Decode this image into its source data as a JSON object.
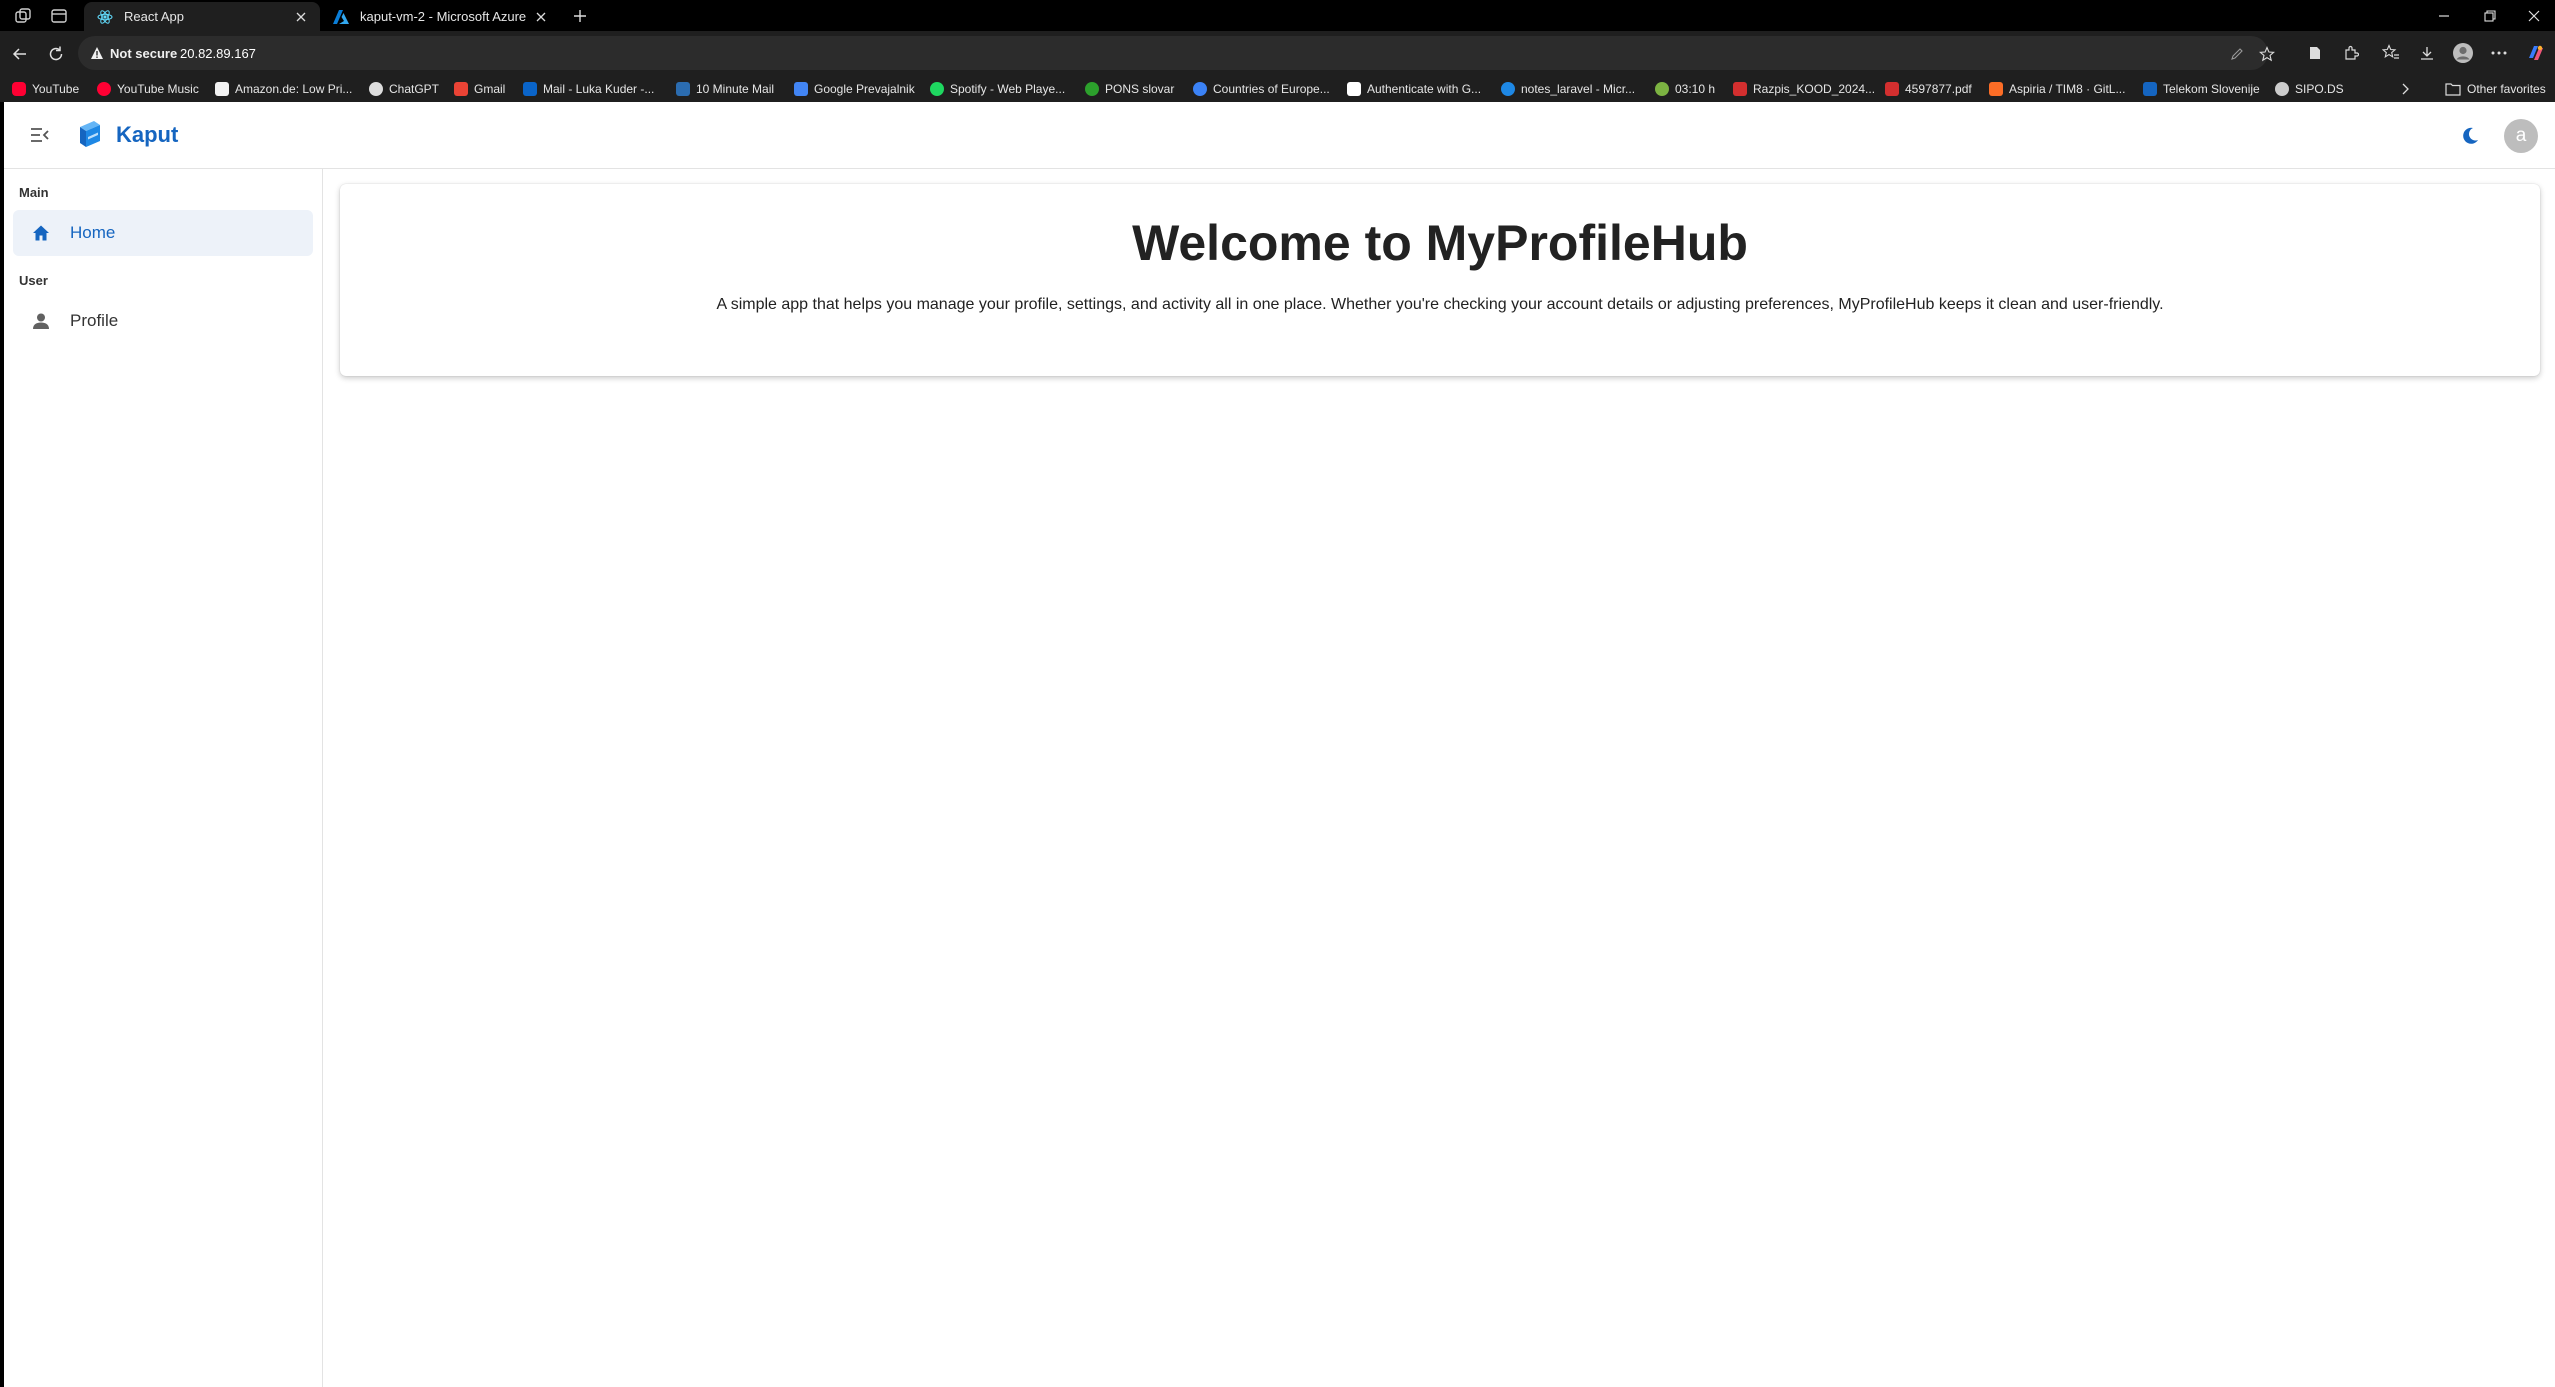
{
  "browser": {
    "tabs": [
      {
        "title": "React App",
        "active": true
      },
      {
        "title": "kaput-vm-2 - Microsoft Azure",
        "active": false
      }
    ],
    "address": {
      "security_label": "Not secure",
      "url": "20.82.89.167"
    },
    "favorites": [
      {
        "label": "YouTube",
        "icon_color": "#ff0033"
      },
      {
        "label": "YouTube Music",
        "icon_color": "#ff0033"
      },
      {
        "label": "Amazon.de: Low Pri...",
        "icon_color": "#f2f2f2"
      },
      {
        "label": "ChatGPT",
        "icon_color": "#dddddd"
      },
      {
        "label": "Gmail",
        "icon_color": "#ea4335"
      },
      {
        "label": "Mail - Luka Kuder -...",
        "icon_color": "#0a64c8"
      },
      {
        "label": "10 Minute Mail",
        "icon_color": "#2b6cb0"
      },
      {
        "label": "Google Prevajalnik",
        "icon_color": "#4285f4"
      },
      {
        "label": "Spotify - Web Playe...",
        "icon_color": "#1ed760"
      },
      {
        "label": "PONS slovar",
        "icon_color": "#2ca02c"
      },
      {
        "label": "Countries of Europe...",
        "icon_color": "#3b82f6"
      },
      {
        "label": "Authenticate with G...",
        "icon_color": "#ffffff"
      },
      {
        "label": "notes_laravel - Micr...",
        "icon_color": "#1e88e5"
      },
      {
        "label": "03:10 h",
        "icon_color": "#7cb342"
      },
      {
        "label": "Razpis_KOOD_2024...",
        "icon_color": "#d32f2f"
      },
      {
        "label": "4597877.pdf",
        "icon_color": "#d32f2f"
      },
      {
        "label": "Aspiria / TIM8 · GitL...",
        "icon_color": "#fc6d26"
      },
      {
        "label": "Telekom Slovenije",
        "icon_color": "#1565c0"
      },
      {
        "label": "SIPO.DS",
        "icon_color": "#cccccc"
      }
    ],
    "other_favorites": "Other favorites"
  },
  "app": {
    "brand": "Kaput",
    "avatar_initial": "a",
    "accent_color": "#1565c0",
    "sidebar": {
      "sections": [
        {
          "label": "Main",
          "items": [
            {
              "label": "Home",
              "icon": "home-icon",
              "active": true
            }
          ]
        },
        {
          "label": "User",
          "items": [
            {
              "label": "Profile",
              "icon": "person-icon",
              "active": false
            }
          ]
        }
      ]
    },
    "welcome": {
      "title": "Welcome to MyProfileHub",
      "subtitle": "A simple app that helps you manage your profile, settings, and activity all in one place. Whether you're checking your account details or adjusting preferences, MyProfileHub keeps it clean and user-friendly."
    }
  }
}
